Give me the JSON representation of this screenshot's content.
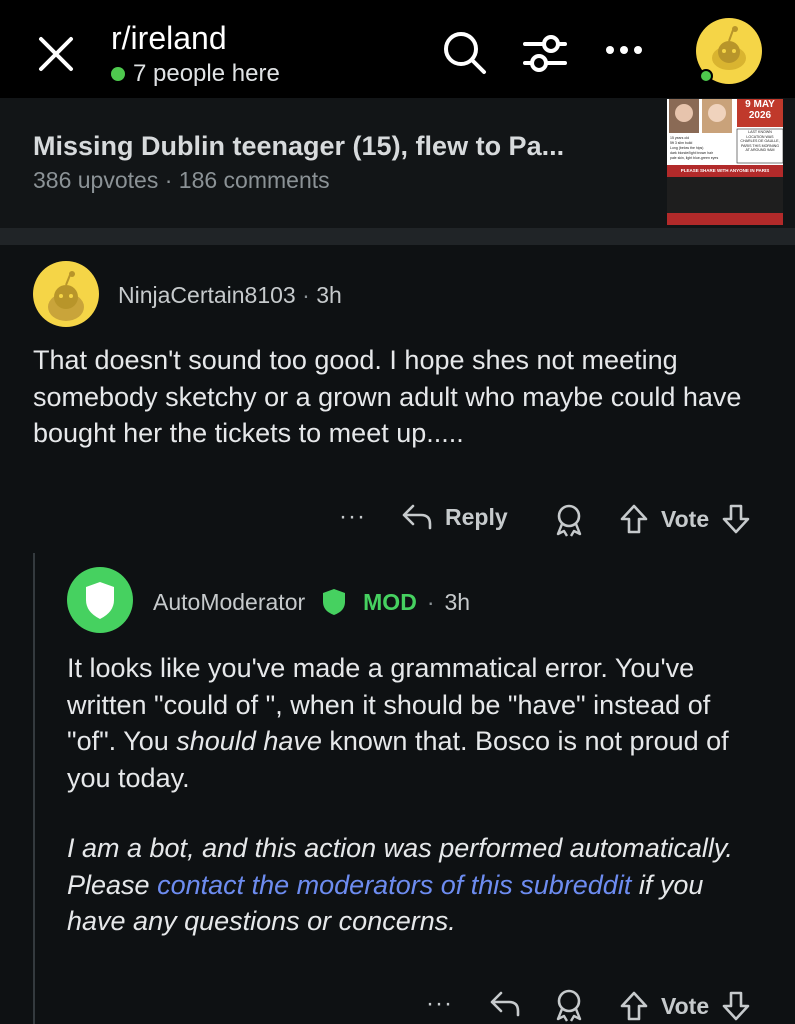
{
  "header": {
    "subreddit": "r/ireland",
    "online_text": "7 people here"
  },
  "post": {
    "title": "Missing Dublin teenager (15), flew to Pa...",
    "upvotes": "386 upvotes",
    "separator": "·",
    "comments": "186 comments",
    "thumbnail": {
      "date_line1": "9 MAY",
      "date_line2": "2026",
      "location_text": "LAST KNOWN LOCATION WAS CHARLES DE GAULLE, PARIS THIS MORNING AT AROUND 9AM",
      "banner": "PLEASE SHARE WITH ANYONE IN PARIS"
    }
  },
  "comments": [
    {
      "username": "NinjaCertain8103",
      "time": "3h",
      "text": "That doesn't sound too good. I hope shes not meeting somebody sketchy or a grown adult who maybe could have bought her the tickets to meet up.....",
      "actions": {
        "more": "···",
        "reply": "Reply",
        "vote": "Vote"
      }
    },
    {
      "username": "AutoModerator",
      "mod_label": "MOD",
      "time": "3h",
      "text_p1_a": "It looks like you've made a grammatical error. You've written \"could of \", when it should be \"have\" instead of \"of\". You ",
      "text_p1_em": "should have",
      "text_p1_b": " known that. Bosco is not proud of you today.",
      "text_p2_a": "I am a bot, and this action was performed automatically. Please ",
      "text_p2_link": "contact the moderators of this subreddit",
      "text_p2_b": " if you have any questions or concerns.",
      "actions": {
        "more": "···",
        "vote": "Vote"
      }
    }
  ],
  "colors": {
    "online_dot": "#4ec94e",
    "mod_green": "#46d160",
    "link_blue": "#6d8cf0",
    "snoo_yellow": "#f5d547"
  }
}
